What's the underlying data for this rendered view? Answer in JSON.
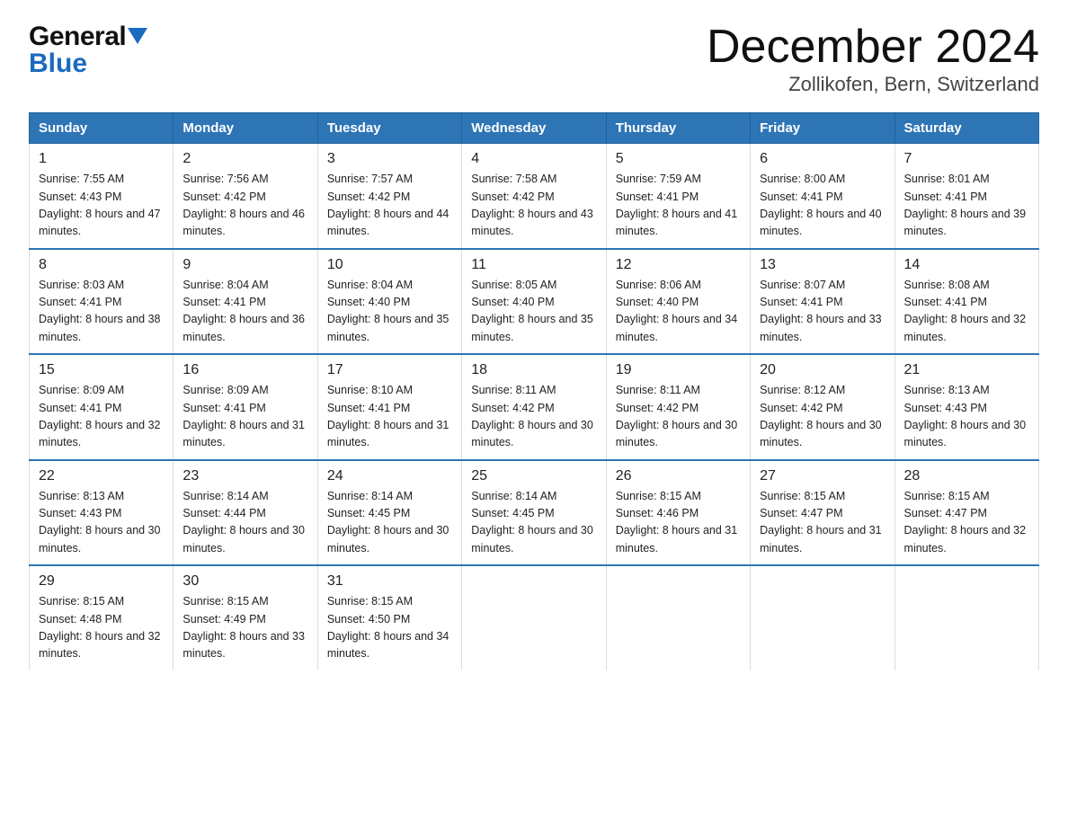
{
  "header": {
    "logo_line1": "General",
    "logo_line2": "Blue",
    "title": "December 2024",
    "subtitle": "Zollikofen, Bern, Switzerland"
  },
  "days_of_week": [
    "Sunday",
    "Monday",
    "Tuesday",
    "Wednesday",
    "Thursday",
    "Friday",
    "Saturday"
  ],
  "weeks": [
    [
      {
        "day": "1",
        "sunrise": "7:55 AM",
        "sunset": "4:43 PM",
        "daylight": "8 hours and 47 minutes."
      },
      {
        "day": "2",
        "sunrise": "7:56 AM",
        "sunset": "4:42 PM",
        "daylight": "8 hours and 46 minutes."
      },
      {
        "day": "3",
        "sunrise": "7:57 AM",
        "sunset": "4:42 PM",
        "daylight": "8 hours and 44 minutes."
      },
      {
        "day": "4",
        "sunrise": "7:58 AM",
        "sunset": "4:42 PM",
        "daylight": "8 hours and 43 minutes."
      },
      {
        "day": "5",
        "sunrise": "7:59 AM",
        "sunset": "4:41 PM",
        "daylight": "8 hours and 41 minutes."
      },
      {
        "day": "6",
        "sunrise": "8:00 AM",
        "sunset": "4:41 PM",
        "daylight": "8 hours and 40 minutes."
      },
      {
        "day": "7",
        "sunrise": "8:01 AM",
        "sunset": "4:41 PM",
        "daylight": "8 hours and 39 minutes."
      }
    ],
    [
      {
        "day": "8",
        "sunrise": "8:03 AM",
        "sunset": "4:41 PM",
        "daylight": "8 hours and 38 minutes."
      },
      {
        "day": "9",
        "sunrise": "8:04 AM",
        "sunset": "4:41 PM",
        "daylight": "8 hours and 36 minutes."
      },
      {
        "day": "10",
        "sunrise": "8:04 AM",
        "sunset": "4:40 PM",
        "daylight": "8 hours and 35 minutes."
      },
      {
        "day": "11",
        "sunrise": "8:05 AM",
        "sunset": "4:40 PM",
        "daylight": "8 hours and 35 minutes."
      },
      {
        "day": "12",
        "sunrise": "8:06 AM",
        "sunset": "4:40 PM",
        "daylight": "8 hours and 34 minutes."
      },
      {
        "day": "13",
        "sunrise": "8:07 AM",
        "sunset": "4:41 PM",
        "daylight": "8 hours and 33 minutes."
      },
      {
        "day": "14",
        "sunrise": "8:08 AM",
        "sunset": "4:41 PM",
        "daylight": "8 hours and 32 minutes."
      }
    ],
    [
      {
        "day": "15",
        "sunrise": "8:09 AM",
        "sunset": "4:41 PM",
        "daylight": "8 hours and 32 minutes."
      },
      {
        "day": "16",
        "sunrise": "8:09 AM",
        "sunset": "4:41 PM",
        "daylight": "8 hours and 31 minutes."
      },
      {
        "day": "17",
        "sunrise": "8:10 AM",
        "sunset": "4:41 PM",
        "daylight": "8 hours and 31 minutes."
      },
      {
        "day": "18",
        "sunrise": "8:11 AM",
        "sunset": "4:42 PM",
        "daylight": "8 hours and 30 minutes."
      },
      {
        "day": "19",
        "sunrise": "8:11 AM",
        "sunset": "4:42 PM",
        "daylight": "8 hours and 30 minutes."
      },
      {
        "day": "20",
        "sunrise": "8:12 AM",
        "sunset": "4:42 PM",
        "daylight": "8 hours and 30 minutes."
      },
      {
        "day": "21",
        "sunrise": "8:13 AM",
        "sunset": "4:43 PM",
        "daylight": "8 hours and 30 minutes."
      }
    ],
    [
      {
        "day": "22",
        "sunrise": "8:13 AM",
        "sunset": "4:43 PM",
        "daylight": "8 hours and 30 minutes."
      },
      {
        "day": "23",
        "sunrise": "8:14 AM",
        "sunset": "4:44 PM",
        "daylight": "8 hours and 30 minutes."
      },
      {
        "day": "24",
        "sunrise": "8:14 AM",
        "sunset": "4:45 PM",
        "daylight": "8 hours and 30 minutes."
      },
      {
        "day": "25",
        "sunrise": "8:14 AM",
        "sunset": "4:45 PM",
        "daylight": "8 hours and 30 minutes."
      },
      {
        "day": "26",
        "sunrise": "8:15 AM",
        "sunset": "4:46 PM",
        "daylight": "8 hours and 31 minutes."
      },
      {
        "day": "27",
        "sunrise": "8:15 AM",
        "sunset": "4:47 PM",
        "daylight": "8 hours and 31 minutes."
      },
      {
        "day": "28",
        "sunrise": "8:15 AM",
        "sunset": "4:47 PM",
        "daylight": "8 hours and 32 minutes."
      }
    ],
    [
      {
        "day": "29",
        "sunrise": "8:15 AM",
        "sunset": "4:48 PM",
        "daylight": "8 hours and 32 minutes."
      },
      {
        "day": "30",
        "sunrise": "8:15 AM",
        "sunset": "4:49 PM",
        "daylight": "8 hours and 33 minutes."
      },
      {
        "day": "31",
        "sunrise": "8:15 AM",
        "sunset": "4:50 PM",
        "daylight": "8 hours and 34 minutes."
      },
      null,
      null,
      null,
      null
    ]
  ],
  "labels": {
    "sunrise": "Sunrise:",
    "sunset": "Sunset:",
    "daylight": "Daylight:"
  }
}
